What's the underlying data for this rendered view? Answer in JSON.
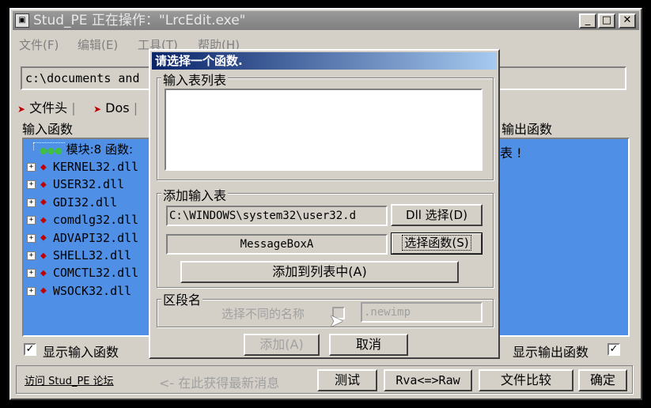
{
  "window": {
    "title": "Stud_PE 正在操作：\"LrcEdit.exe\"",
    "min": "_",
    "max": "□",
    "close": "✕"
  },
  "menu": [
    "文件(F)",
    "编辑(E)",
    "工具(T)",
    "帮助(H)"
  ],
  "path_value": "c:\\documents and",
  "tabs": [
    "文件头",
    "Dos"
  ],
  "imports": {
    "label": "输入函数",
    "module_summary": "模块:8 函数:",
    "modules": [
      "KERNEL32.dll",
      "USER32.dll",
      "GDI32.dll",
      "comdlg32.dll",
      "ADVAPI32.dll",
      "SHELL32.dll",
      "COMCTL32.dll",
      "WSOCK32.dll"
    ],
    "show_label": "显示输入函数",
    "checked": "✓"
  },
  "exports": {
    "label": "输出函数",
    "text": "表 !",
    "show_label": "显示输出函数",
    "checked": "✓"
  },
  "bottom": {
    "forum_link": "访问 Stud_PE 论坛",
    "news": "<- 在此获得最新消息",
    "test": "测试",
    "rva_raw": "Rva<=>Raw",
    "compare": "文件比较",
    "ok": "确定"
  },
  "dialog": {
    "title": "请选择一个函数.",
    "import_list_label": "输入表列表",
    "add_import_label": "添加输入表",
    "dll_path": "C:\\WINDOWS\\system32\\user32.d",
    "dll_select": "Dll 选择(D)",
    "function_name": "MessageBoxA",
    "select_function": "选择函数(S)",
    "add_to_list": "添加到列表中(A)",
    "section_label": "区段名",
    "diff_name_label": "选择不同的名称",
    "section_value": ".newimp",
    "add": "添加(A)",
    "cancel": "取消"
  }
}
